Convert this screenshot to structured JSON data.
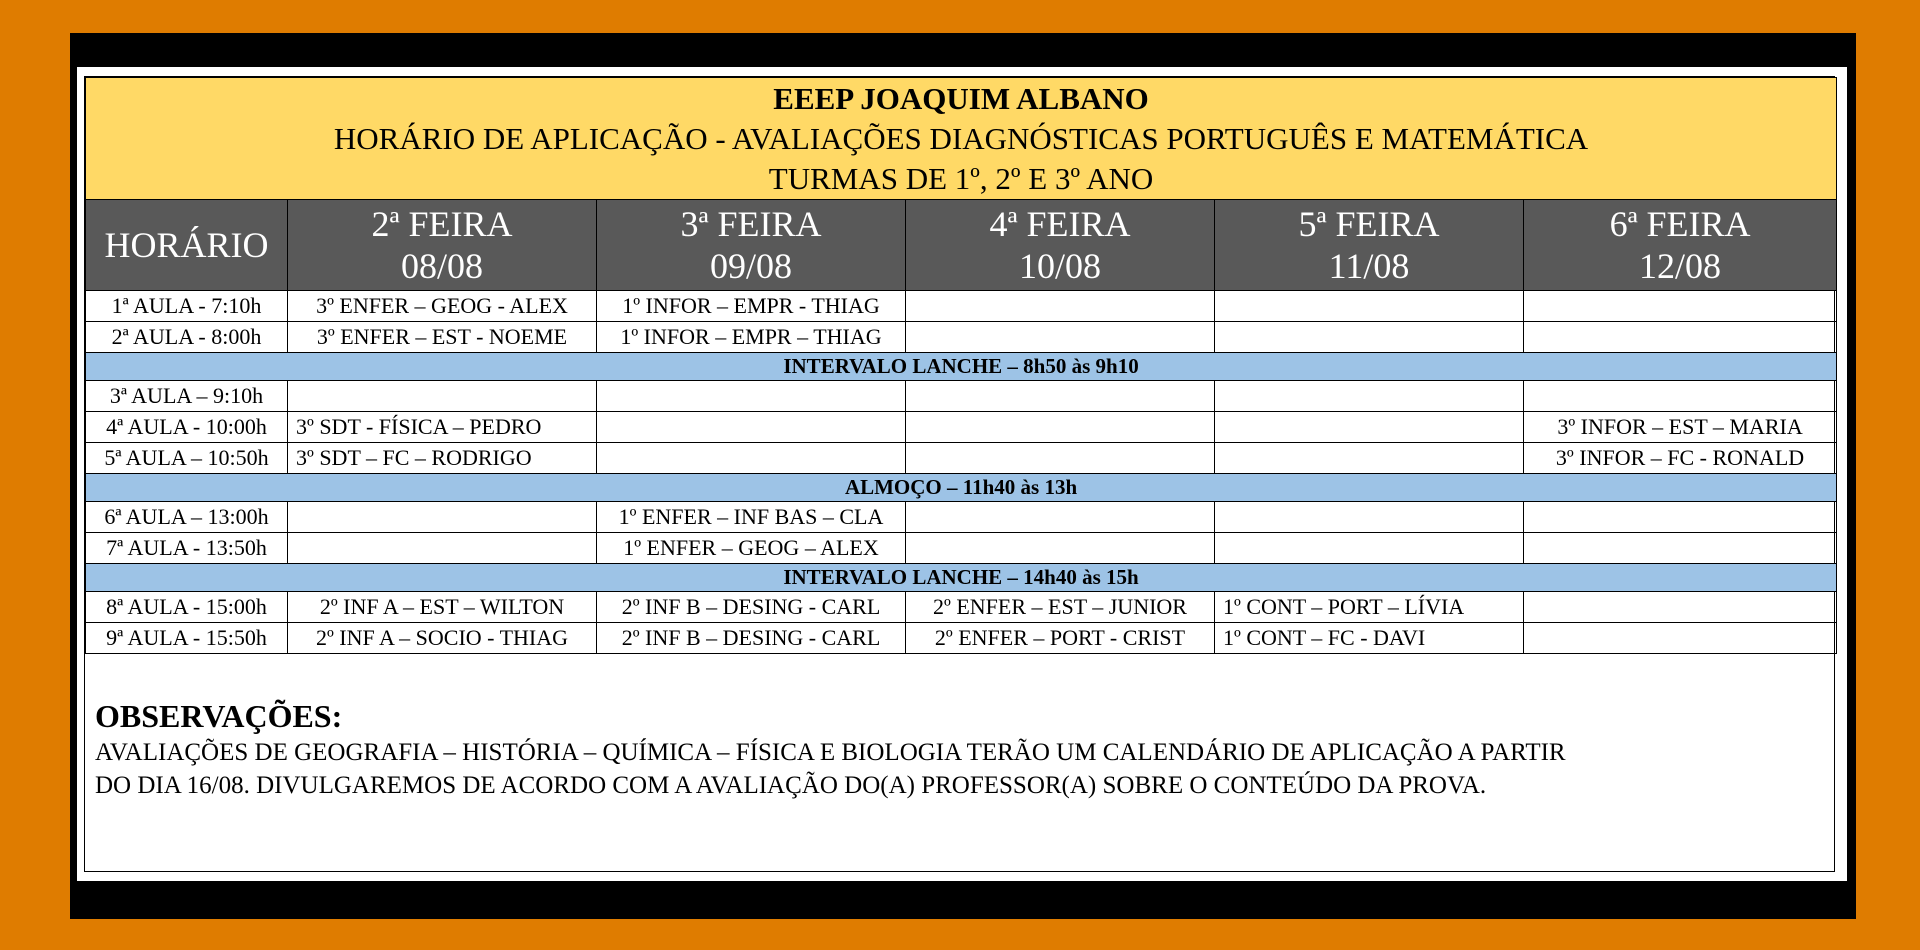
{
  "header": {
    "school": "EEEP JOAQUIM ALBANO",
    "subtitle": "HORÁRIO DE APLICAÇÃO  - AVALIAÇÕES DIAGNÓSTICAS PORTUGUÊS E MATEMÁTICA",
    "classes": "TURMAS DE 1º, 2º E 3º ANO"
  },
  "columns": {
    "time_label": "HORÁRIO",
    "days": [
      {
        "day": "2ª FEIRA",
        "date": "08/08"
      },
      {
        "day": "3ª FEIRA",
        "date": "09/08"
      },
      {
        "day": "4ª FEIRA",
        "date": "10/08"
      },
      {
        "day": "5ª FEIRA",
        "date": "11/08"
      },
      {
        "day": "6ª FEIRA",
        "date": "12/08"
      }
    ]
  },
  "rows": {
    "r1": {
      "time": "1ª AULA - 7:10h",
      "c": [
        "3º ENFER – GEOG  - ALEX",
        "1º INFOR – EMPR - THIAG",
        "",
        "",
        ""
      ]
    },
    "r2": {
      "time": "2ª AULA - 8:00h",
      "c": [
        "3º ENFER – EST - NOEME",
        "1º INFOR – EMPR – THIAG",
        "",
        "",
        ""
      ]
    },
    "break1": "INTERVALO LANCHE – 8h50 às 9h10",
    "r3": {
      "time": "3ª AULA – 9:10h",
      "c": [
        "",
        "",
        "",
        "",
        ""
      ]
    },
    "r4": {
      "time": "4ª AULA - 10:00h",
      "c": [
        "3º SDT  - FÍSICA – PEDRO",
        "",
        "",
        "",
        "3º INFOR – EST – MARIA"
      ]
    },
    "r5": {
      "time": "5ª AULA – 10:50h",
      "c": [
        "3º SDT – FC – RODRIGO",
        "",
        "",
        "",
        "3º INFOR – FC - RONALD"
      ]
    },
    "break2": "ALMOÇO – 11h40 às 13h",
    "r6": {
      "time": "6ª AULA – 13:00h",
      "c": [
        "",
        "1º ENFER – INF BAS – CLA",
        "",
        "",
        ""
      ]
    },
    "r7": {
      "time": "7ª AULA - 13:50h",
      "c": [
        "",
        "1º ENFER – GEOG – ALEX",
        "",
        "",
        ""
      ]
    },
    "break3": "INTERVALO LANCHE – 14h40 às 15h",
    "r8": {
      "time": "8ª AULA - 15:00h",
      "c": [
        "2º INF A – EST – WILTON",
        "2º INF B – DESING - CARL",
        "2º ENFER – EST – JUNIOR",
        "1º CONT – PORT – LÍVIA",
        ""
      ]
    },
    "r9": {
      "time": "9ª AULA - 15:50h",
      "c": [
        "2º INF A – SOCIO - THIAG",
        "2º INF B – DESING - CARL",
        "2º ENFER – PORT - CRIST",
        "1º CONT – FC - DAVI",
        ""
      ]
    }
  },
  "notes": {
    "title": "OBSERVAÇÕES:",
    "line1": "AVALIAÇÕES DE GEOGRAFIA – HISTÓRIA – QUÍMICA – FÍSICA E BIOLOGIA TERÃO UM CALENDÁRIO DE APLICAÇÃO A PARTIR",
    "line2": "DO DIA 16/08. DIVULGAREMOS DE ACORDO COM A AVALIAÇÃO DO(A) PROFESSOR(A) SOBRE O CONTEÚDO DA PROVA."
  },
  "colors": {
    "background": "#df7c00",
    "title_band": "#ffd966",
    "header_row": "#595959",
    "break_row": "#9dc3e6"
  }
}
